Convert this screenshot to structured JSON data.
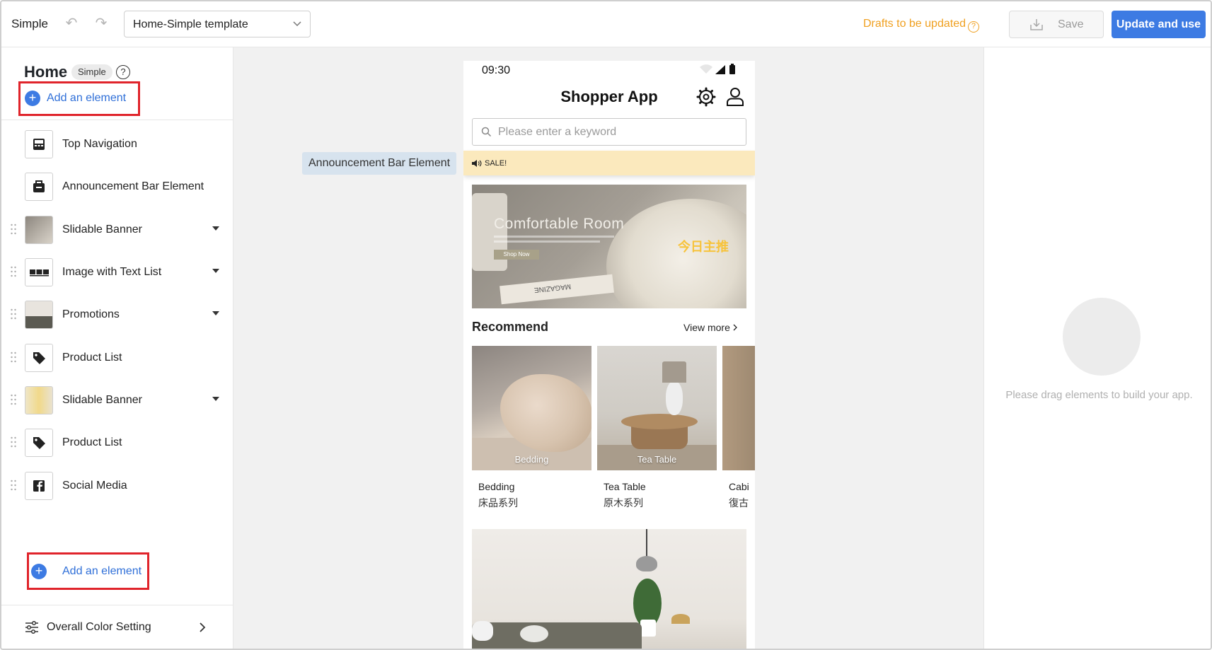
{
  "header": {
    "app_name": "Simple",
    "template_value": "Home-Simple template",
    "drafts_label": "Drafts to be updated",
    "save_label": "Save",
    "update_label": "Update and use"
  },
  "sidebar": {
    "page_title": "Home",
    "page_badge": "Simple",
    "add_element_label": "Add an element",
    "items": [
      {
        "label": "Top Navigation",
        "icon": "top-nav-icon",
        "draggable": false,
        "expandable": false
      },
      {
        "label": "Announcement Bar Element",
        "icon": "bag-icon",
        "draggable": false,
        "expandable": false
      },
      {
        "label": "Slidable Banner",
        "icon": "banner-thumb",
        "draggable": true,
        "expandable": true
      },
      {
        "label": "Image with Text List",
        "icon": "image-list-icon",
        "draggable": true,
        "expandable": true
      },
      {
        "label": "Promotions",
        "icon": "promotions-thumb",
        "draggable": true,
        "expandable": true
      },
      {
        "label": "Product List",
        "icon": "tag-icon",
        "draggable": true,
        "expandable": false
      },
      {
        "label": "Slidable Banner",
        "icon": "banner-thumb-2",
        "draggable": true,
        "expandable": true
      },
      {
        "label": "Product List",
        "icon": "tag-icon",
        "draggable": true,
        "expandable": false
      },
      {
        "label": "Social Media",
        "icon": "facebook-icon",
        "draggable": true,
        "expandable": false
      }
    ],
    "add_element_bottom_label": "Add an element",
    "color_setting_label": "Overall Color Setting"
  },
  "canvas": {
    "announcement_tag": "Announcement Bar Element",
    "phone": {
      "time": "09:30",
      "title": "Shopper App",
      "search_placeholder": "Please enter a keyword",
      "announcement_text": "SALE!",
      "banner": {
        "title": "Comfortable Room",
        "button": "Shop Now",
        "book_text": "MAGAZINE",
        "zh_text": "今日主推"
      },
      "recommend_title": "Recommend",
      "view_more": "View more",
      "cards": [
        {
          "caption": "Bedding",
          "name": "Bedding",
          "series": "床品系列"
        },
        {
          "caption": "Tea Table",
          "name": "Tea Table",
          "series": "原木系列"
        },
        {
          "caption": "",
          "name": "Cabi",
          "series": "復古"
        }
      ]
    }
  },
  "right_panel": {
    "placeholder_text": "Please drag elements to build your app."
  },
  "colors": {
    "accent": "#3d7be3",
    "drafts": "#f0a020",
    "highlight_box": "#e0242b",
    "announcement_bg": "#fbe9bd"
  }
}
